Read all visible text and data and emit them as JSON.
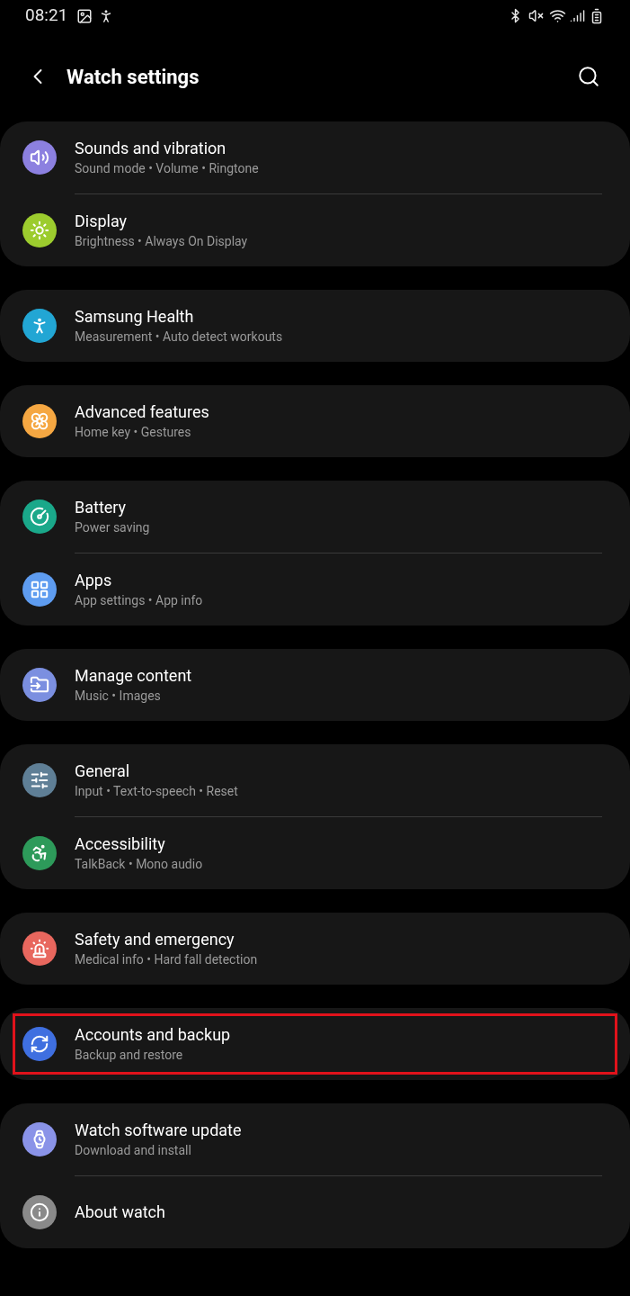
{
  "status_bar": {
    "time": "08:21"
  },
  "header": {
    "title": "Watch settings"
  },
  "groups": [
    {
      "items": [
        {
          "title": "Sounds and vibration",
          "subtitle": "Sound mode • Volume • Ringtone",
          "color": "#8c80e0",
          "highlighted": false
        },
        {
          "title": "Display",
          "subtitle": "Brightness • Always On Display",
          "color": "#9ccc2e",
          "highlighted": false
        }
      ]
    },
    {
      "items": [
        {
          "title": "Samsung Health",
          "subtitle": "Measurement • Auto detect workouts",
          "color": "#22a6d4",
          "highlighted": false
        }
      ]
    },
    {
      "items": [
        {
          "title": "Advanced features",
          "subtitle": "Home key • Gestures",
          "color": "#f5a742",
          "highlighted": false
        }
      ]
    },
    {
      "items": [
        {
          "title": "Battery",
          "subtitle": "Power saving",
          "color": "#1aa88a",
          "highlighted": false
        },
        {
          "title": "Apps",
          "subtitle": "App settings • App info",
          "color": "#5e9cf0",
          "highlighted": false
        }
      ]
    },
    {
      "items": [
        {
          "title": "Manage content",
          "subtitle": "Music • Images",
          "color": "#7b8fe0",
          "highlighted": false
        }
      ]
    },
    {
      "items": [
        {
          "title": "General",
          "subtitle": "Input • Text-to-speech • Reset",
          "color": "#5f7f96",
          "highlighted": false
        },
        {
          "title": "Accessibility",
          "subtitle": "TalkBack • Mono audio",
          "color": "#2d9a5a",
          "highlighted": false
        }
      ]
    },
    {
      "items": [
        {
          "title": "Safety and emergency",
          "subtitle": "Medical info • Hard fall detection",
          "color": "#e8675e",
          "highlighted": false
        }
      ]
    },
    {
      "items": [
        {
          "title": "Accounts and backup",
          "subtitle": "Backup and restore",
          "color": "#3f6fe0",
          "highlighted": true
        }
      ]
    },
    {
      "items": [
        {
          "title": "Watch software update",
          "subtitle": "Download and install",
          "color": "#8a93e8",
          "highlighted": false
        },
        {
          "title": "About watch",
          "color": "#8a8a8a",
          "highlighted": false
        }
      ]
    }
  ]
}
